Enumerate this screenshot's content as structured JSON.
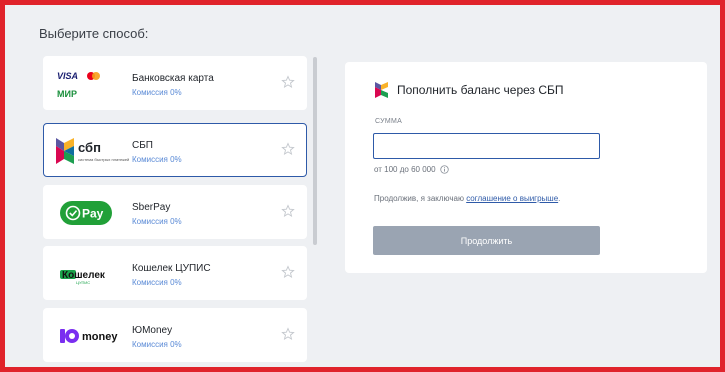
{
  "page": {
    "title": "Выберите способ:"
  },
  "methods": [
    {
      "id": "card",
      "name": "Банковская карта",
      "fee": "Комиссия 0%",
      "logo_text": [
        "VISA",
        "МИР"
      ],
      "selected": false
    },
    {
      "id": "sbp",
      "name": "СБП",
      "fee": "Комиссия 0%",
      "logo_text": [
        "сбп",
        "система быстрых платежей"
      ],
      "selected": true
    },
    {
      "id": "sberpay",
      "name": "SberPay",
      "fee": "Комиссия 0%",
      "logo_text": [
        "Pay"
      ],
      "selected": false
    },
    {
      "id": "cupis",
      "name": "Кошелек ЦУПИС",
      "fee": "Комиссия 0%",
      "logo_text": [
        "Кошелек",
        "ЦУПИС"
      ],
      "selected": false
    },
    {
      "id": "yoomoney",
      "name": "ЮMoney",
      "fee": "Комиссия 0%",
      "logo_text": [
        "money"
      ],
      "selected": false
    }
  ],
  "panel": {
    "title": "Пополнить баланс через СБП",
    "amount_label": "СУММА",
    "amount_value": "",
    "range_text": "от 100 до 60 000",
    "agree_prefix": "Продолжив, я заключаю ",
    "agree_link": "соглашение о выигрыше",
    "agree_suffix": ".",
    "continue_label": "Продолжить"
  },
  "colors": {
    "highlight_border": "#e0232b",
    "selected_border": "#2e5aa8",
    "fee_text": "#5a8ad6",
    "button_disabled": "#9aa4b2",
    "sberpay_green": "#21a038"
  },
  "icons": [
    "visa-logo",
    "mastercard-logo",
    "mir-logo",
    "sbp-logo",
    "sberpay-logo",
    "cupis-logo",
    "yoomoney-logo",
    "star-icon",
    "info-icon"
  ]
}
